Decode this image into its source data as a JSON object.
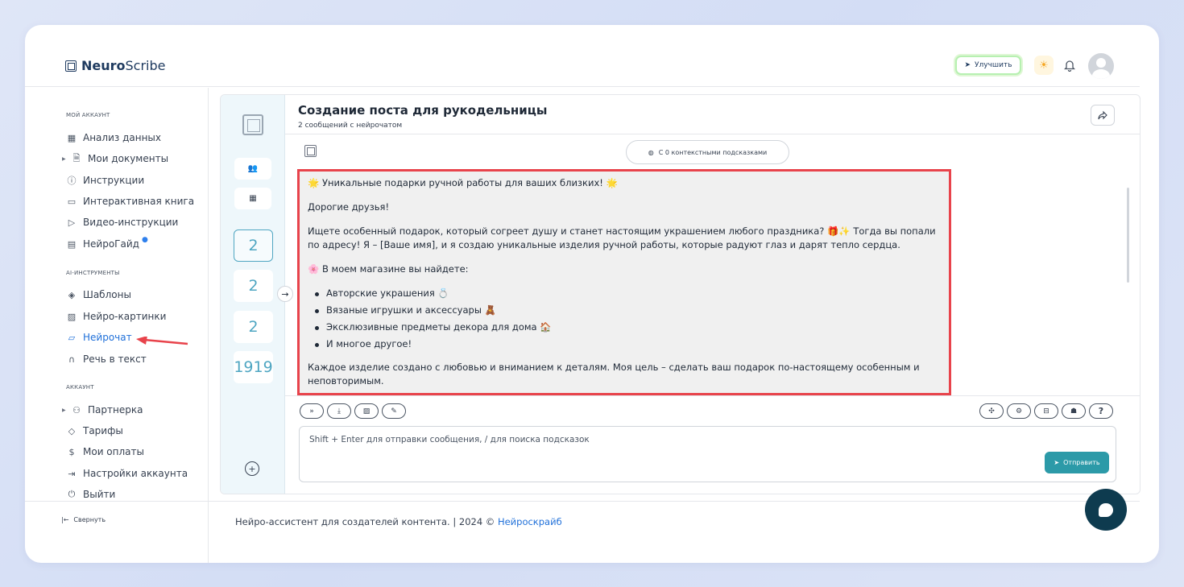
{
  "brand": {
    "name_bold": "Neuro",
    "name_rest": "Scribe"
  },
  "header": {
    "upgrade_label": "Улучшить"
  },
  "sidebar": {
    "section_account": "МОЙ АККАУНТ",
    "account_items": [
      {
        "label": "Анализ данных",
        "icon": "grid-icon"
      },
      {
        "label": "Мои документы",
        "icon": "document-icon"
      },
      {
        "label": "Инструкции",
        "icon": "help-icon"
      },
      {
        "label": "Интерактивная книга",
        "icon": "book-icon"
      },
      {
        "label": "Видео-инструкции",
        "icon": "video-icon"
      },
      {
        "label": "НейроГайд",
        "icon": "guide-icon"
      }
    ],
    "section_ai": "AI-ИНСТРУМЕНТЫ",
    "ai_items": [
      {
        "label": "Шаблоны",
        "icon": "layers-icon"
      },
      {
        "label": "Нейро-картинки",
        "icon": "image-icon"
      },
      {
        "label": "Нейрочат",
        "icon": "chat-icon"
      },
      {
        "label": "Речь в текст",
        "icon": "headphones-icon"
      }
    ],
    "section_acc": "АККАУНТ",
    "acc_items": [
      {
        "label": "Партнерка",
        "icon": "users-icon"
      },
      {
        "label": "Тарифы",
        "icon": "tag-icon"
      },
      {
        "label": "Мои оплаты",
        "icon": "dollar-icon"
      },
      {
        "label": "Настройки аккаунта",
        "icon": "login-icon"
      },
      {
        "label": "Выйти",
        "icon": "power-icon"
      }
    ],
    "collapse_label": "Свернуть"
  },
  "rail": {
    "counts": [
      "2",
      "2",
      "2",
      "1919"
    ]
  },
  "chat": {
    "title": "Создание поста для рукодельницы",
    "subtitle": "2 сообщений с нейрочатом",
    "context_label": "С 0 контекстными подсказками",
    "message": {
      "headline": "🌟 Уникальные подарки ручной работы для ваших близких! 🌟",
      "greeting": "Дорогие друзья!",
      "intro": "Ищете особенный подарок, который согреет душу и станет настоящим украшением любого праздника? 🎁✨ Тогда вы попали по адресу! Я – [Ваше имя], и я создаю уникальные изделия ручной работы, которые радуют глаз и дарят тепло сердца.",
      "store_intro": "🌸 В моем магазине вы найдете:",
      "bullets": [
        "Авторские украшения 💍",
        "Вязаные игрушки и аксессуары 🧸",
        "Эксклюзивные предметы декора для дома 🏠",
        "И многое другое!"
      ],
      "closing": "Каждое изделие создано с любовью и вниманием к деталям. Моя цель – сделать ваш подарок по-настоящему особенным и неповторимым."
    },
    "input_placeholder": "Shift + Enter для отправки сообщения, / для поиска подсказок",
    "send_label": "Отправить"
  },
  "footer": {
    "text": "Нейро-ассистент для создателей контента.  | 2024 © ",
    "link": "Нейроскрайб"
  },
  "colors": {
    "accent": "#2c9aa8",
    "highlight_border": "#e8434b",
    "link": "#1e6fd9"
  }
}
